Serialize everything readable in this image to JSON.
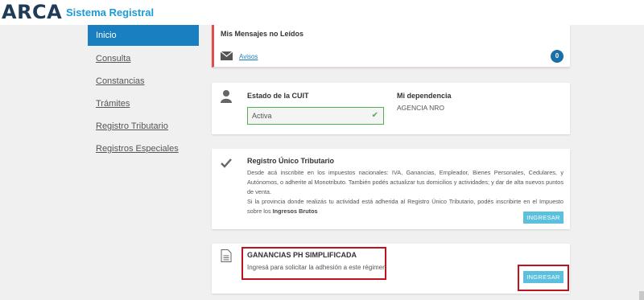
{
  "header": {
    "logo": "ARCA",
    "app_title": "Sistema Registral"
  },
  "sidebar": {
    "items": [
      {
        "label": "Inicio",
        "active": true
      },
      {
        "label": "Consulta"
      },
      {
        "label": "Constancias"
      },
      {
        "label": "Trámites"
      },
      {
        "label": "Registro Tributario"
      },
      {
        "label": "Registros Especiales"
      }
    ]
  },
  "messages": {
    "title": "Mis Mensajes no Leídos",
    "link": "Avisos",
    "count": "0",
    "icon": "envelope-icon"
  },
  "cuit": {
    "label": "Estado de la CUIT",
    "status": "Activa",
    "dependency_label": "Mi dependencia",
    "dependency_value": "AGENCIA NRO",
    "icon": "user-icon"
  },
  "rut": {
    "title": "Registro Único Tributario",
    "text1": "Desde acá inscribite en los impuestos nacionales: IVA, Ganancias, Empleador, Bienes Personales, Cedulares, y Autónomos, o adherite al Monotributo. También podés actualizar tus domicilios y actividades; y dar de alta nuevos puntos de venta.",
    "text2": "Si la provincia donde realizás tu actividad está adherida al Registro Único Tributario, podés inscribirte en el Impuesto sobre los",
    "text2_bold": "Ingresos Brutos",
    "button": "INGRESAR",
    "icon": "checkmark-icon"
  },
  "ganancias": {
    "title": "GANANCIAS PH SIMPLIFICADA",
    "subtitle": "Ingresá para solicitar la adhesión a este régimen",
    "button": "INGRESAR",
    "icon": "document-icon"
  },
  "colors": {
    "brand": "#1f3b57",
    "accent": "#1a7fc1",
    "button": "#5bc0de",
    "success": "#4caf50",
    "highlight": "#c1121f"
  }
}
